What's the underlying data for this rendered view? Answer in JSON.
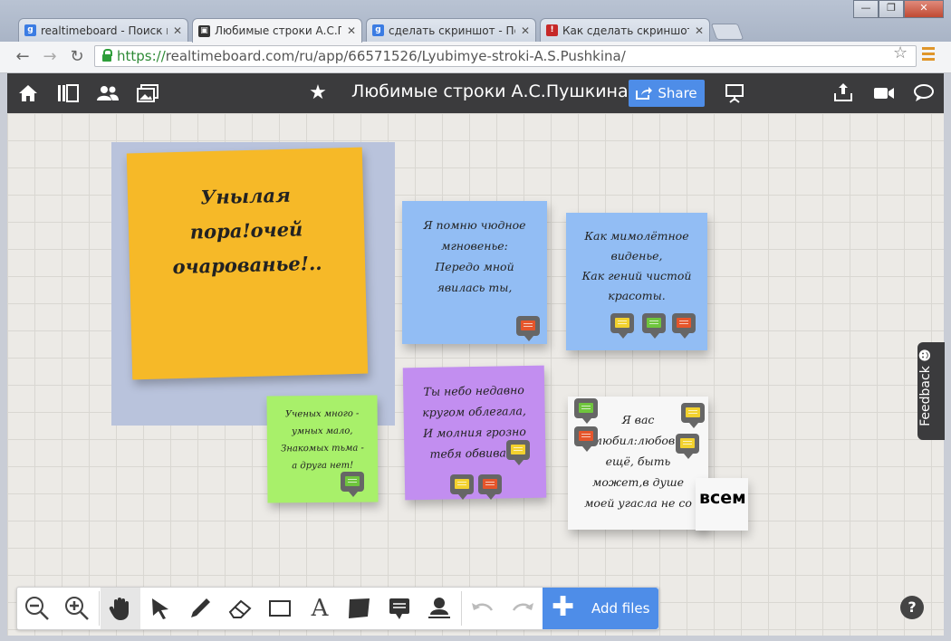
{
  "browser": {
    "tabs": [
      {
        "title": "realtimeboard - Поиск в G",
        "favicon": "google-icon",
        "color": "#3b7ce3",
        "glyph": "g"
      },
      {
        "title": "Любимые строки А.С.Пу",
        "favicon": "realtimeboard-icon",
        "color": "#333333",
        "glyph": "▣"
      },
      {
        "title": "сделать скриншот - Пои",
        "favicon": "google-icon",
        "color": "#3b7ce3",
        "glyph": "g"
      },
      {
        "title": "Как сделать скриншот —",
        "favicon": "page-icon",
        "color": "#c62828",
        "glyph": "!"
      }
    ],
    "url_scheme": "https://",
    "url_rest": "realtimeboard.com/ru/app/66571526/Lyubimye-stroki-A.S.Pushkina/"
  },
  "app": {
    "title": "Любимые строки А.С.Пушкина",
    "share_label": "Share",
    "accent": "#4e8de8"
  },
  "notes": [
    {
      "id": "yellow",
      "text": "Унылая\nпора!очей\nочарованье!..",
      "color": "#f6b928"
    },
    {
      "id": "blue1",
      "text": "Я помню чюдное\nмгновенье:\nПередо мной\nявилась ты,",
      "color": "#92bdf4"
    },
    {
      "id": "blue2",
      "text": "Как мимолётное\nвиденье,\nКак гений чистой\nкрасоты.",
      "color": "#92bdf4"
    },
    {
      "id": "green",
      "text": "Ученых много -\nумных мало,\nЗнакомых тьма -\nа друга нет!",
      "color": "#a8f06a"
    },
    {
      "id": "purple",
      "text": "Ты небо недавно\nкругом облегала,\nИ молния грозно\nтебя обвивала",
      "color": "#c28ef0"
    },
    {
      "id": "white",
      "text": "Я вас\nлюбил:любовь\nещё, быть\nможет,в душе\nмоей угасла не со",
      "color": "#f7f7f7"
    }
  ],
  "white_note_tail": "всем",
  "comment_colors": {
    "red": "#e6552b",
    "green": "#6fc53d",
    "yellow": "#f2d12e"
  },
  "feedback_label": "Feedback ☻",
  "toolbar": {
    "add_files_label": "Add files",
    "text_tool_glyph": "A",
    "help_label": "?"
  }
}
